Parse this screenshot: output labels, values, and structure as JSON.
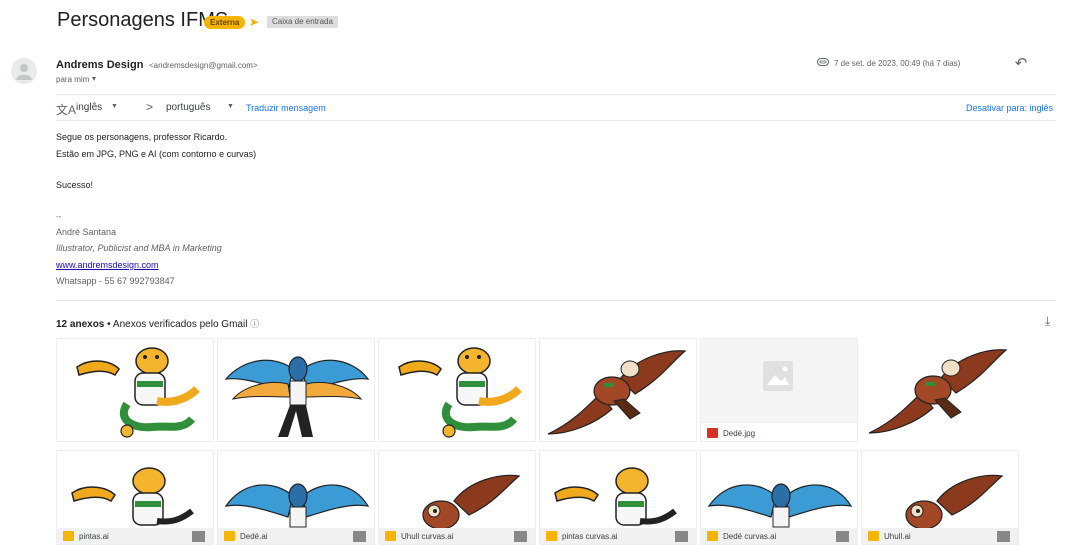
{
  "email": {
    "subject": "Personagens IFMS",
    "labels": {
      "external": "Externa",
      "inbox": "Caixa de entrada"
    },
    "sender": {
      "name": "Andrems Design",
      "email": "<andremsdesign@gmail.com>"
    },
    "to": "para mim",
    "date": "7 de set. de 2023, 00:49 (há 7 dias)"
  },
  "translate": {
    "from": "inglês",
    "to": "português",
    "action": "Traduzir mensagem",
    "disable": "Desativar para: inglês"
  },
  "body": {
    "lines": [
      "Segue os personagens, professor Ricardo.",
      "Estão em JPG, PNG e AI (com contorno e curvas)",
      "Sucesso!"
    ],
    "signature": {
      "dash": "--",
      "name": "André Santana",
      "title": "Illustrator, Publicist and MBA in Marketing",
      "website": "www.andremsdesign.com",
      "phone": "Whatsapp - 55 67 992793847"
    }
  },
  "attachments": {
    "count_label": "12 anexos",
    "separator": "•",
    "note": "Anexos verificados pelo Gmail",
    "items": [
      {
        "character": "jaguar",
        "name": ""
      },
      {
        "character": "macaw",
        "name": ""
      },
      {
        "character": "jaguar",
        "name": ""
      },
      {
        "character": "bird-brown",
        "name": ""
      },
      {
        "character": "placeholder",
        "name": "Dedé.jpg",
        "type": "image"
      },
      {
        "character": "bird-brown",
        "name": ""
      },
      {
        "character": "jaguar",
        "name": "pintas.ai",
        "type": "ai"
      },
      {
        "character": "macaw",
        "name": "Dedé.ai",
        "type": "ai"
      },
      {
        "character": "bird-brown",
        "name": "Uhull curvas.ai",
        "type": "ai"
      },
      {
        "character": "jaguar",
        "name": "pintas curvas.ai",
        "type": "ai"
      },
      {
        "character": "macaw",
        "name": "Dedé curvas.ai",
        "type": "ai"
      },
      {
        "character": "bird-brown",
        "name": "Uhull.ai",
        "type": "ai"
      }
    ]
  },
  "colors": {
    "badge_external": "#f5b400",
    "link": "#1a73e8",
    "ai_file": "#f5b400",
    "image_file": "#d93025"
  },
  "icons": {
    "reply": "reply-icon",
    "translate": "translate-icon",
    "download": "download-icon",
    "info": "info-icon",
    "attachment": "attachment-icon"
  }
}
